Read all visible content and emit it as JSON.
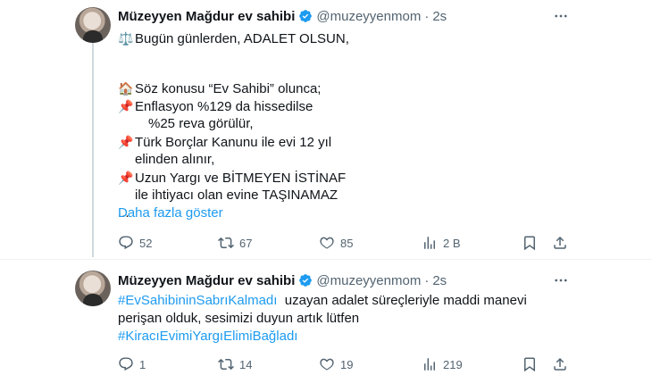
{
  "tweets": [
    {
      "name": "Müzeyyen Mağdur ev sahibi",
      "handle": "@muzeyyenmom",
      "separator": "·",
      "time": "2s",
      "lines": [
        {
          "emoji": "⚖️",
          "text": "Bugün günlerden, ADALET OLSUN,"
        },
        {
          "emoji": "",
          "text": ""
        },
        {
          "emoji": "🏠",
          "text": "Söz konusu “Ev Sahibi” olunca;"
        },
        {
          "emoji": "📌",
          "text": "Enflasyon %129 da hissedilse"
        },
        {
          "emoji": "",
          "text": "%25 reva görülür,"
        },
        {
          "emoji": "📌",
          "text": "Türk Borçlar Kanunu ile evi 12 yıl"
        },
        {
          "emoji": "",
          "text": "elinden alınır,"
        },
        {
          "emoji": "📌",
          "text": "Uzun Yargı ve BİTMEYEN İSTİNAF"
        },
        {
          "emoji": "",
          "text": "ile ihtiyacı olan evine TAŞINAMAZ"
        },
        {
          "emoji": "",
          "text": "..."
        }
      ],
      "show_more": "Daha fazla göster",
      "actions": {
        "replies": "52",
        "retweets": "67",
        "likes": "85",
        "views": "2 B"
      }
    },
    {
      "name": "Müzeyyen Mağdur ev sahibi",
      "handle": "@muzeyyenmom",
      "separator": "·",
      "time": "2s",
      "hashtag1": "#EvSahibininSabrıKalmadı",
      "text1": "uzayan adalet süreçleriyle maddi manevi",
      "text2": "perişan olduk, sesimizi duyun artık lütfen",
      "hashtag2": "#KiracıEvimiYargıElimiBağladı",
      "actions": {
        "replies": "1",
        "retweets": "14",
        "likes": "19",
        "views": "219"
      }
    }
  ],
  "icons": {
    "verified": "verified-badge-icon",
    "more": "more-options-icon",
    "reply": "reply-icon",
    "retweet": "retweet-icon",
    "like": "like-icon",
    "views": "views-icon",
    "bookmark": "bookmark-icon",
    "share": "share-icon"
  },
  "colors": {
    "accent": "#1d9bf0",
    "muted": "#536471",
    "text": "#0f1419",
    "thread_line": "#cfd9de"
  }
}
